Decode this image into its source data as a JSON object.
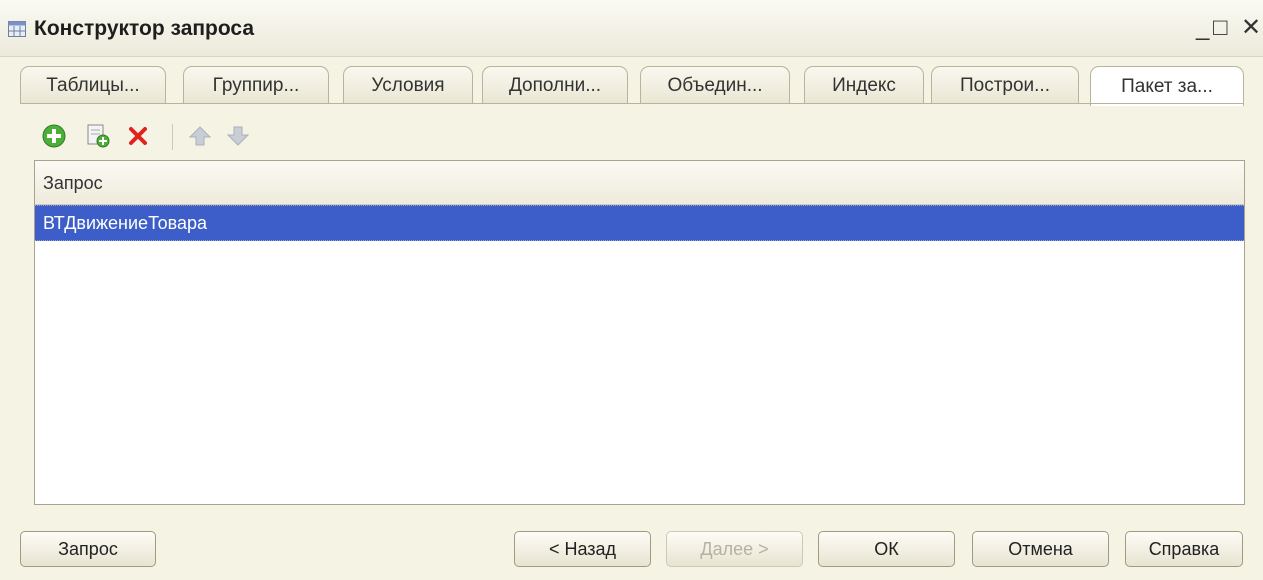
{
  "window": {
    "title": "Конструктор запроса",
    "minimize_glyph": "_",
    "maximize_glyph": "□",
    "close_glyph": "✕"
  },
  "tabs": [
    {
      "label": "Таблицы..."
    },
    {
      "label": "Группир..."
    },
    {
      "label": "Условия"
    },
    {
      "label": "Дополни..."
    },
    {
      "label": "Объедин..."
    },
    {
      "label": "Индекс"
    },
    {
      "label": "Построи..."
    },
    {
      "label": "Пакет за...",
      "active": true
    }
  ],
  "toolbar": {
    "icons": [
      "add-icon",
      "copy-icon",
      "delete-icon",
      "move-up-icon",
      "move-down-icon"
    ]
  },
  "table": {
    "column_header": "Запрос",
    "rows": [
      {
        "query": "ВТДвижениеТовара",
        "selected": true
      }
    ]
  },
  "buttons": {
    "query": "Запрос",
    "back": "< Назад",
    "next": "Далее >",
    "ok": "ОК",
    "cancel": "Отмена",
    "help": "Справка"
  },
  "colors": {
    "selection": "#3d5ec8",
    "background": "#f5f3e4"
  }
}
